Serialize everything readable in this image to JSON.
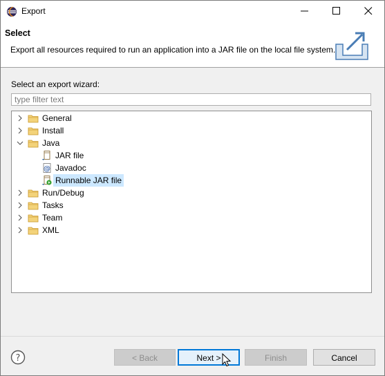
{
  "window": {
    "title": "Export",
    "app_icon": "eclipse-icon",
    "controls": [
      "minimize-icon",
      "maximize-icon",
      "close-icon"
    ]
  },
  "header": {
    "title": "Select",
    "description": "Export all resources required to run an application into a JAR file on the local file system.",
    "image": "export-wizard-banner-icon"
  },
  "wizard": {
    "label": "Select an export wizard:",
    "filter_placeholder": "type filter text",
    "filter_value": "",
    "tree": [
      {
        "label": "General",
        "icon": "folder-icon",
        "expanded": false
      },
      {
        "label": "Install",
        "icon": "folder-icon",
        "expanded": false
      },
      {
        "label": "Java",
        "icon": "folder-icon",
        "expanded": true
      },
      {
        "label": "JAR file",
        "icon": "jar-file-icon"
      },
      {
        "label": "Javadoc",
        "icon": "javadoc-icon"
      },
      {
        "label": "Runnable JAR file",
        "icon": "runnable-jar-icon",
        "selected": true
      },
      {
        "label": "Run/Debug",
        "icon": "folder-icon",
        "expanded": false
      },
      {
        "label": "Tasks",
        "icon": "folder-icon",
        "expanded": false
      },
      {
        "label": "Team",
        "icon": "folder-icon",
        "expanded": false
      },
      {
        "label": "XML",
        "icon": "folder-icon",
        "expanded": false
      }
    ]
  },
  "footer": {
    "help_icon": "help-icon",
    "back": "< Back",
    "next": "Next >",
    "finish": "Finish",
    "cancel": "Cancel"
  },
  "colors": {
    "selection": "#cce8ff",
    "default_button_border": "#0078d7",
    "folder": "#e8b84a"
  }
}
